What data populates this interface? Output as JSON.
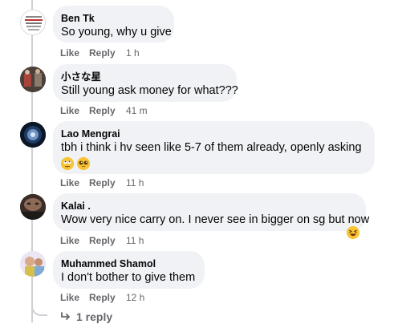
{
  "comments": [
    {
      "author": "Ben Tk",
      "text": "So young, why u give",
      "like_label": "Like",
      "reply_label": "Reply",
      "time": "1 h"
    },
    {
      "author": "小さな星",
      "text": "Still young ask money for what???",
      "like_label": "Like",
      "reply_label": "Reply",
      "time": "41 m"
    },
    {
      "author": "Lao Mengrai",
      "text": "tbh i think i hv seen like 5-7 of them already, openly asking",
      "like_label": "Like",
      "reply_label": "Reply",
      "time": "11 h"
    },
    {
      "author": "Kalai .",
      "text": "Wow very nice carry on. I never see in bigger on sg but now",
      "like_label": "Like",
      "reply_label": "Reply",
      "time": "11 h"
    },
    {
      "author": "Muhammed Shamol",
      "text": "I don't bother to give them",
      "like_label": "Like",
      "reply_label": "Reply",
      "time": "12 h"
    }
  ],
  "replies_link": "1 reply",
  "colors": {
    "bubble": "#f0f2f5",
    "meta": "#65676b",
    "thread_line": "#ced0d4",
    "emoji": "#f7c435"
  },
  "icons": {
    "emoji_1": "face-with-rolling-eyes-icon",
    "emoji_2": "pleading-face-icon",
    "emoji_3": "grinning-squinting-face-icon",
    "reply_arrow": "reply-arrow-icon"
  }
}
